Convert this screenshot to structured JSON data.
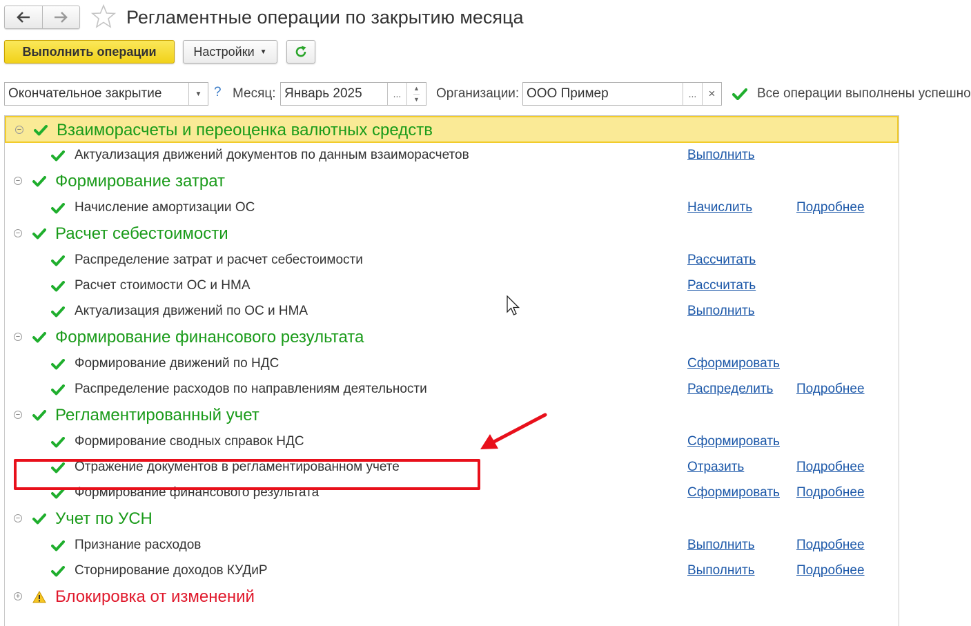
{
  "window": {
    "title": "Регламентные операции по закрытию месяца"
  },
  "toolbar": {
    "execute_label": "Выполнить операции",
    "settings_label": "Настройки"
  },
  "filters": {
    "mode_value": "Окончательное закрытие",
    "help_label": "?",
    "month_label": "Месяц:",
    "month_value": "Январь 2025",
    "org_label": "Организации:",
    "org_value": "ООО Пример",
    "status_text": "Все операции выполнены успешно",
    "ellipsis": "...",
    "clear": "×"
  },
  "colors": {
    "success": "#1fae2d",
    "group_title": "#1a9b1a",
    "warning_title": "#e0192c",
    "link": "#1b57a8",
    "highlight": "#e8101b"
  },
  "groups": [
    {
      "title": "Взаиморасчеты и переоценка валютных средств",
      "status": "success",
      "expanded": true,
      "items": [
        {
          "title": "Актуализация движений документов по данным взаиморасчетов",
          "action": "Выполнить",
          "details": ""
        }
      ]
    },
    {
      "title": "Формирование затрат",
      "status": "success",
      "expanded": true,
      "items": [
        {
          "title": "Начисление амортизации ОС",
          "action": "Начислить",
          "details": "Подробнее"
        }
      ]
    },
    {
      "title": "Расчет себестоимости",
      "status": "success",
      "expanded": true,
      "items": [
        {
          "title": "Распределение затрат и расчет себестоимости",
          "action": "Рассчитать",
          "details": ""
        },
        {
          "title": "Расчет стоимости ОС и НМА",
          "action": "Рассчитать",
          "details": ""
        },
        {
          "title": "Актуализация движений по ОС и НМА",
          "action": "Выполнить",
          "details": ""
        }
      ]
    },
    {
      "title": "Формирование финансового результата",
      "status": "success",
      "expanded": true,
      "items": [
        {
          "title": "Формирование движений по НДС",
          "action": "Сформировать",
          "details": ""
        },
        {
          "title": "Распределение расходов по направлениям деятельности",
          "action": "Распределить",
          "details": "Подробнее"
        }
      ]
    },
    {
      "title": "Регламентированный учет",
      "status": "success",
      "expanded": true,
      "items": [
        {
          "title": "Формирование сводных справок НДС",
          "action": "Сформировать",
          "details": ""
        },
        {
          "title": "Отражение документов в регламентированном учете",
          "action": "Отразить",
          "details": "Подробнее"
        },
        {
          "title": "Формирование финансового результата",
          "action": "Сформировать",
          "details": "Подробнее"
        }
      ]
    },
    {
      "title": "Учет по УСН",
      "status": "success",
      "expanded": true,
      "items": [
        {
          "title": "Признание расходов",
          "action": "Выполнить",
          "details": "Подробнее"
        },
        {
          "title": "Сторнирование доходов КУДиР",
          "action": "Выполнить",
          "details": "Подробнее"
        }
      ]
    },
    {
      "title": "Блокировка от изменений",
      "status": "warning",
      "expanded": false,
      "items": []
    }
  ],
  "icons": {
    "back": "arrow-left-icon",
    "forward": "arrow-right-icon",
    "favorite": "star-icon",
    "refresh": "refresh-icon",
    "check": "checkmark-icon",
    "warning": "warning-triangle-icon",
    "collapse": "collapse-icon",
    "expand": "expand-icon"
  }
}
